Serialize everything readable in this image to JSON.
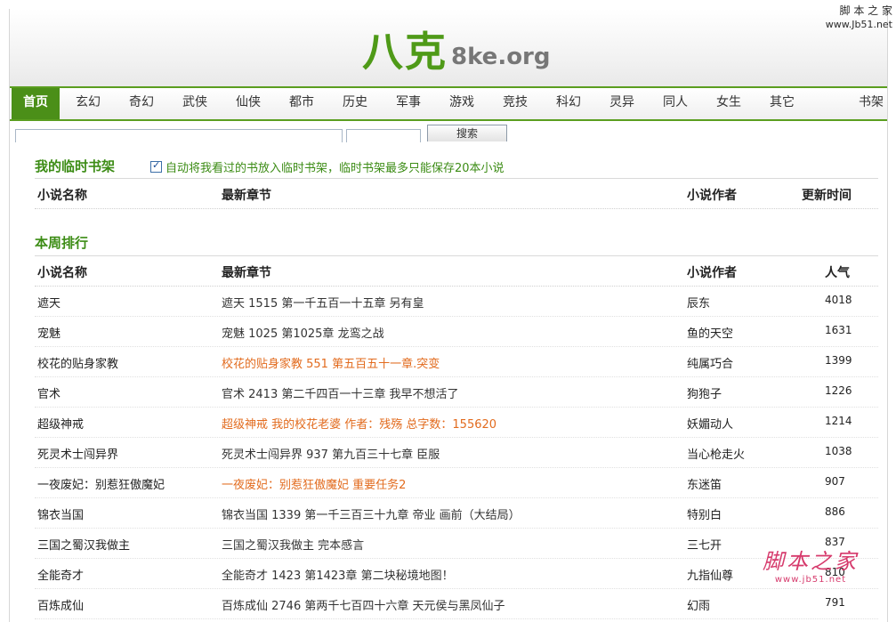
{
  "site": {
    "logo_cn": "八克",
    "logo_en": "8ke.org"
  },
  "watermark": {
    "top_title": "脚 本 之 家",
    "top_url": "www.Jb51.net",
    "bottom_title": "脚本之家",
    "bottom_url": "www.jb51.net"
  },
  "nav": {
    "items": [
      "首页",
      "玄幻",
      "奇幻",
      "武侠",
      "仙侠",
      "都市",
      "历史",
      "军事",
      "游戏",
      "竞技",
      "科幻",
      "灵异",
      "同人",
      "女生",
      "其它"
    ],
    "right": "书架"
  },
  "search": {
    "button_label": "搜索"
  },
  "shelf": {
    "title": "我的临时书架",
    "auto_save_text": "自动将我看过的书放入临时书架，临时书架最多只能保存20本小说",
    "auto_save_checked": true,
    "columns": {
      "name": "小说名称",
      "chapter": "最新章节",
      "author": "小说作者",
      "time": "更新时间"
    }
  },
  "weekly": {
    "title": "本周排行",
    "columns": {
      "name": "小说名称",
      "chapter": "最新章节",
      "author": "小说作者",
      "popularity": "人气"
    },
    "rows": [
      {
        "name": "遮天",
        "chapter": "遮天 1515 第一千五百一十五章 另有皇",
        "author": "辰东",
        "popularity": "4018",
        "hot": false
      },
      {
        "name": "宠魅",
        "chapter": "宠魅 1025 第1025章 龙鸾之战",
        "author": "鱼的天空",
        "popularity": "1631",
        "hot": false
      },
      {
        "name": "校花的贴身家教",
        "chapter": "校花的贴身家教 551 第五百五十一章.突变",
        "author": "纯属巧合",
        "popularity": "1399",
        "hot": true
      },
      {
        "name": "官术",
        "chapter": "官术 2413 第二千四百一十三章 我早不想活了",
        "author": "狗狍子",
        "popularity": "1226",
        "hot": false
      },
      {
        "name": "超级神戒",
        "chapter": "超级神戒 我的校花老婆 作者：残殇 总字数：155620",
        "author": "妖媚动人",
        "popularity": "1214",
        "hot": true
      },
      {
        "name": "死灵术士闯异界",
        "chapter": "死灵术士闯异界 937 第九百三十七章 臣服",
        "author": "当心枪走火",
        "popularity": "1038",
        "hot": false
      },
      {
        "name": "一夜废妃：别惹狂傲魔妃",
        "chapter": "一夜废妃：别惹狂傲魔妃 重要任务2",
        "author": "东迷笛",
        "popularity": "907",
        "hot": true
      },
      {
        "name": "锦衣当国",
        "chapter": "锦衣当国 1339 第一千三百三十九章 帝业 画前（大结局）",
        "author": "特别白",
        "popularity": "886",
        "hot": false
      },
      {
        "name": "三国之蜀汉我做主",
        "chapter": "三国之蜀汉我做主 完本感言",
        "author": "三七开",
        "popularity": "837",
        "hot": false
      },
      {
        "name": "全能奇才",
        "chapter": "全能奇才 1423 第1423章 第二块秘境地图！",
        "author": "九指仙尊",
        "popularity": "810",
        "hot": false
      },
      {
        "name": "百炼成仙",
        "chapter": "百炼成仙 2746 第两千七百四十六章 天元侯与黑凤仙子",
        "author": "幻雨",
        "popularity": "791",
        "hot": false
      }
    ]
  }
}
